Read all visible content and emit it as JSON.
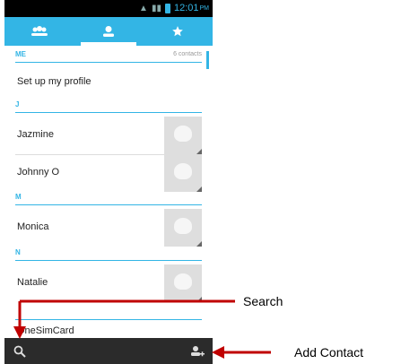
{
  "status_bar": {
    "time": "12:01",
    "ampm": "PM"
  },
  "tabs": [
    {
      "name": "groups",
      "icon": "groups-icon",
      "active": false
    },
    {
      "name": "contacts",
      "icon": "person-icon",
      "active": true
    },
    {
      "name": "favorites",
      "icon": "star-icon",
      "active": false
    }
  ],
  "me_section": {
    "label": "ME",
    "count": "6 contacts"
  },
  "profile": {
    "label": "Set up my profile"
  },
  "sections": [
    {
      "letter": "J",
      "contacts": [
        "Jazmine",
        "Johnny O"
      ]
    },
    {
      "letter": "M",
      "contacts": [
        "Monica"
      ]
    },
    {
      "letter": "N",
      "contacts": [
        "Natalie"
      ]
    }
  ],
  "partial_contact": "OneSimCard",
  "action_bar": {
    "search_icon": "search-icon",
    "add_contact_icon": "add-contact-icon"
  },
  "annotations": {
    "search": "Search",
    "add_contact": "Add Contact"
  },
  "colors": {
    "accent": "#33b5e5",
    "arrow": "#c00000",
    "action_bar": "#2b2b2b"
  }
}
